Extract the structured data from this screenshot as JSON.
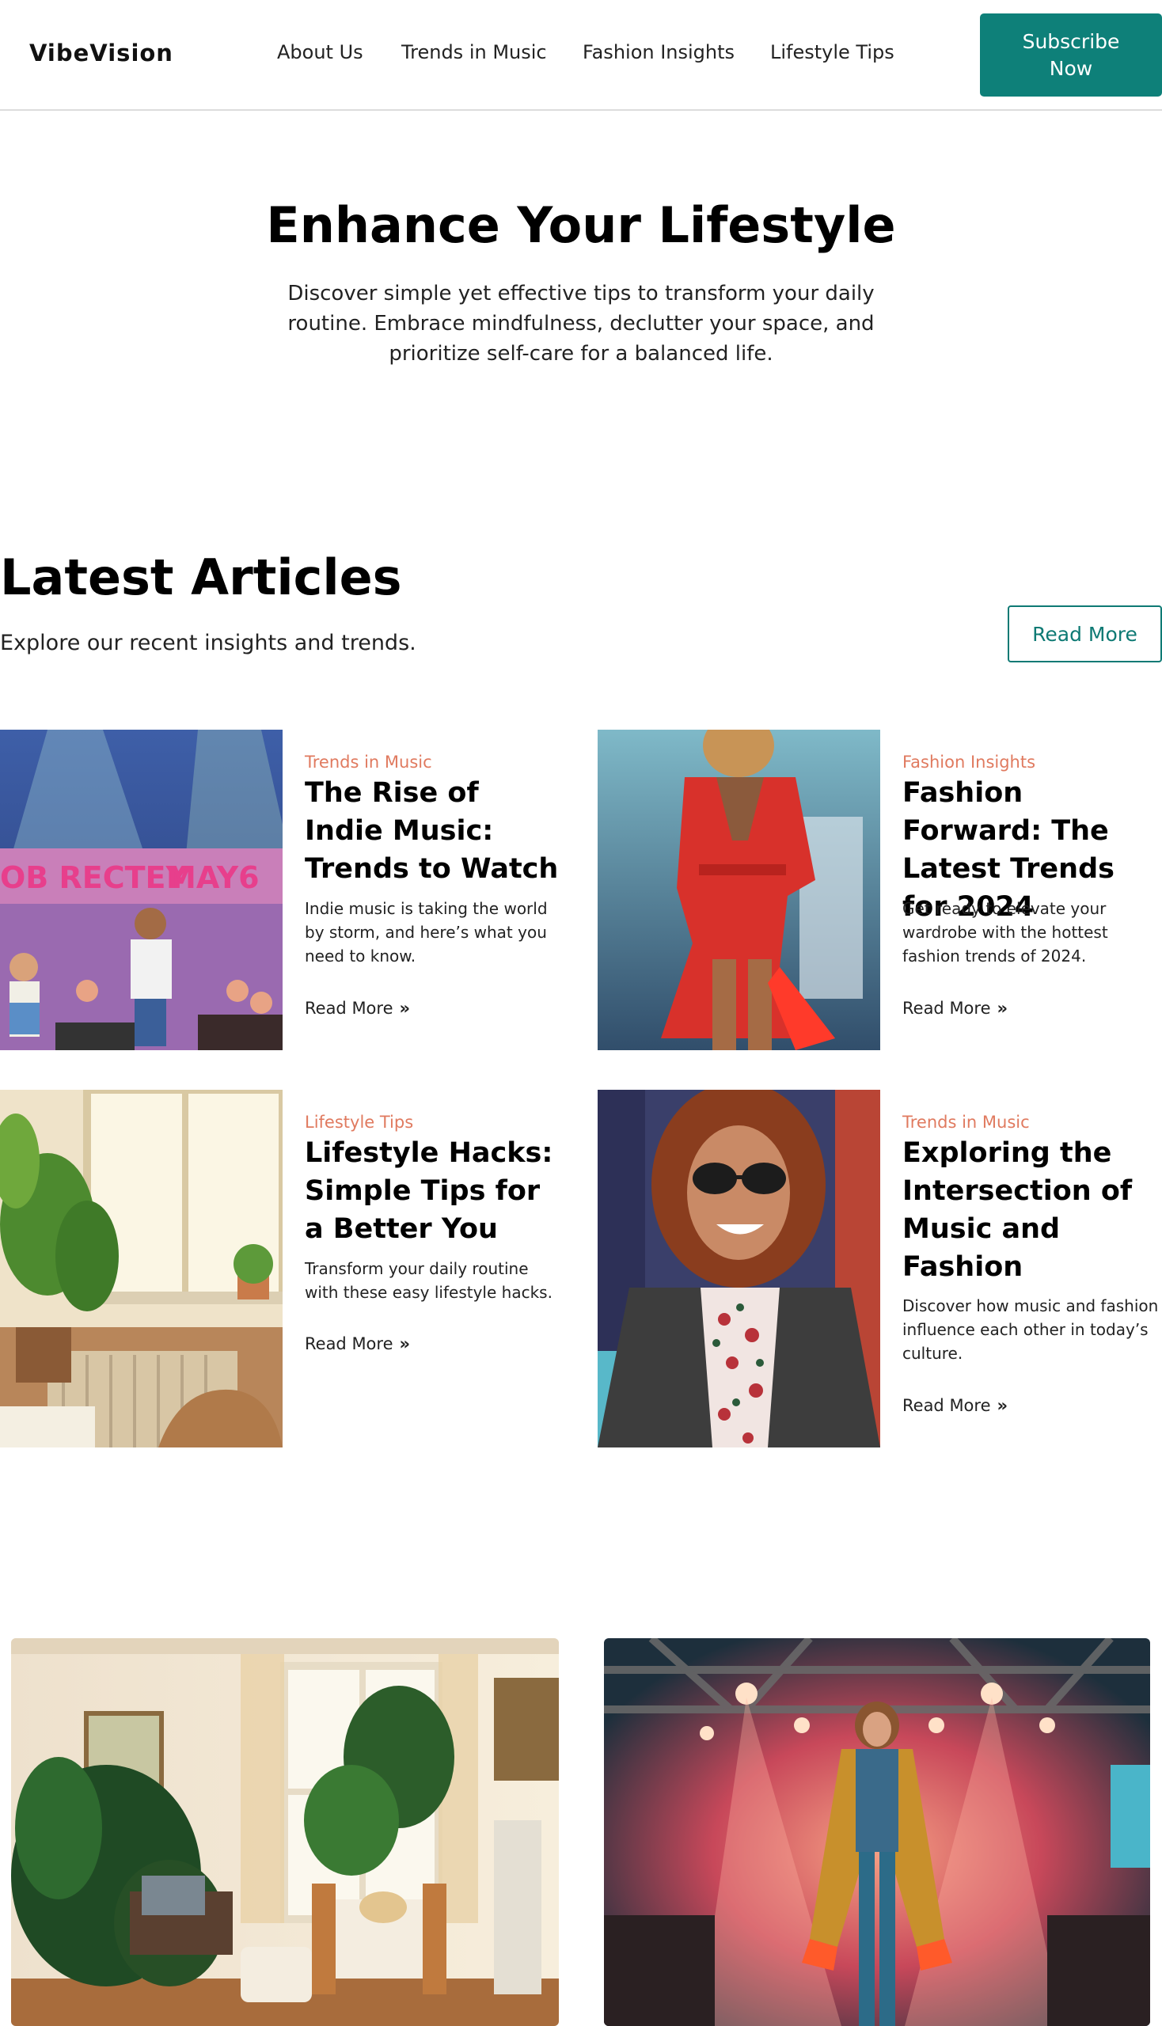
{
  "header": {
    "logo": "VibeVision",
    "nav": [
      "About Us",
      "Trends in Music",
      "Fashion Insights",
      "Lifestyle Tips"
    ],
    "subscribe_label": "Subscribe Now"
  },
  "hero": {
    "title": "Enhance Your Lifestyle",
    "subtitle": "Discover simple yet effective tips to transform your daily routine. Embrace mindfulness, declutter your space, and prioritize self-care for a balanced life."
  },
  "latest": {
    "title": "Latest Articles",
    "subtitle": "Explore our recent insights and trends.",
    "read_more_label": "Read More"
  },
  "articles": [
    {
      "category": "Trends in Music",
      "title": "The Rise of Indie Music: Trends to Watch",
      "description": "Indie music is taking the world by storm, and here’s what you need to know.",
      "link": "Read More",
      "image": "indie-concert-illustration"
    },
    {
      "category": "Fashion Insights",
      "title": "Fashion Forward: The Latest Trends for 2024",
      "description": "Get ready to elevate your wardrobe with the hottest fashion trends of 2024.",
      "link": "Read More",
      "image": "red-dress-runway"
    },
    {
      "category": "Lifestyle Tips",
      "title": "Lifestyle Hacks: Simple Tips for a Better You",
      "description": "Transform your daily routine with these easy lifestyle hacks.",
      "link": "Read More",
      "image": "sunny-room-plants"
    },
    {
      "category": "Trends in Music",
      "title": "Exploring the Intersection of Music and Fashion",
      "description": "Discover how music and fashion influence each other in today’s culture.",
      "link": "Read More",
      "image": "smiling-woman-sunglasses"
    }
  ],
  "gallery": [
    "cozy-living-room-plants",
    "runway-model-spotlights"
  ],
  "colors": {
    "accent": "#0e8079",
    "category": "#e07a5f"
  }
}
